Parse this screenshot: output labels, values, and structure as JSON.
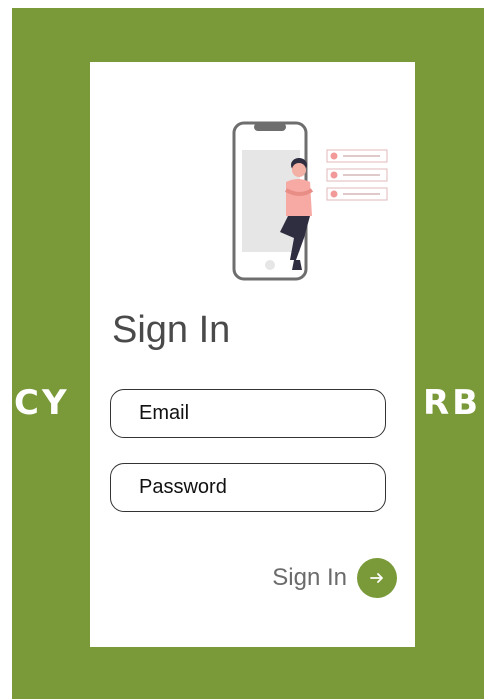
{
  "background": {
    "color": "#7a9a3a",
    "text_left": "CY",
    "text_right": "RB."
  },
  "card": {
    "title": "Sign In",
    "email_placeholder": "Email",
    "password_placeholder": "Password",
    "submit_label": "Sign In",
    "accent_color": "#7a9a3a",
    "illustration_icon": "person-with-phone-illustration",
    "submit_icon": "arrow-right-icon"
  }
}
